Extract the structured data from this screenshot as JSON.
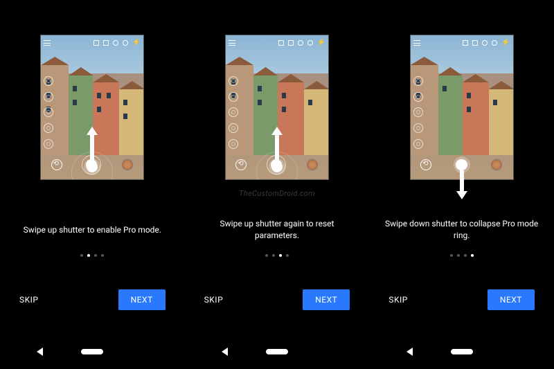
{
  "watermark": "TheCustomDroid.com",
  "screens": [
    {
      "instruction": "Swipe up shutter to enable Pro mode.",
      "skip_label": "SKIP",
      "next_label": "NEXT",
      "active_dot": 1,
      "total_dots": 4,
      "arrow_direction": "up",
      "shutter_ring_visible": true
    },
    {
      "instruction": "Swipe up shutter again to reset parameters.",
      "skip_label": "SKIP",
      "next_label": "NEXT",
      "active_dot": 2,
      "total_dots": 4,
      "arrow_direction": "up",
      "shutter_ring_visible": true
    },
    {
      "instruction": "Swipe down shutter to collapse Pro mode ring.",
      "skip_label": "SKIP",
      "next_label": "NEXT",
      "active_dot": 3,
      "total_dots": 4,
      "arrow_direction": "down",
      "shutter_ring_visible": false
    }
  ],
  "colors": {
    "accent": "#2979ff",
    "background": "#000000",
    "text": "#ffffff"
  }
}
